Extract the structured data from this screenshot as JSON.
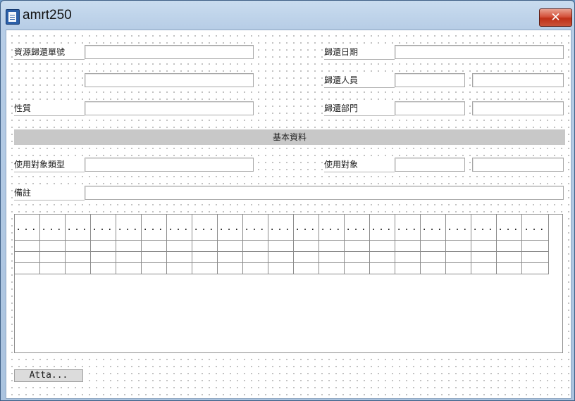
{
  "window": {
    "title": "amrt250",
    "close_glyph": "✕"
  },
  "form": {
    "labels": {
      "return_no": "資源歸還單號",
      "return_date": "歸還日期",
      "returner": "歸還人員",
      "nature": "性質",
      "return_dept": "歸還部門",
      "target_type": "使用對象類型",
      "target": "使用對象",
      "remarks": "備註"
    },
    "section_title": "基本資料"
  },
  "grid": {
    "header_cell": "...",
    "column_count": 21,
    "row_count": 3
  },
  "buttons": {
    "attachment": "Atta..."
  }
}
